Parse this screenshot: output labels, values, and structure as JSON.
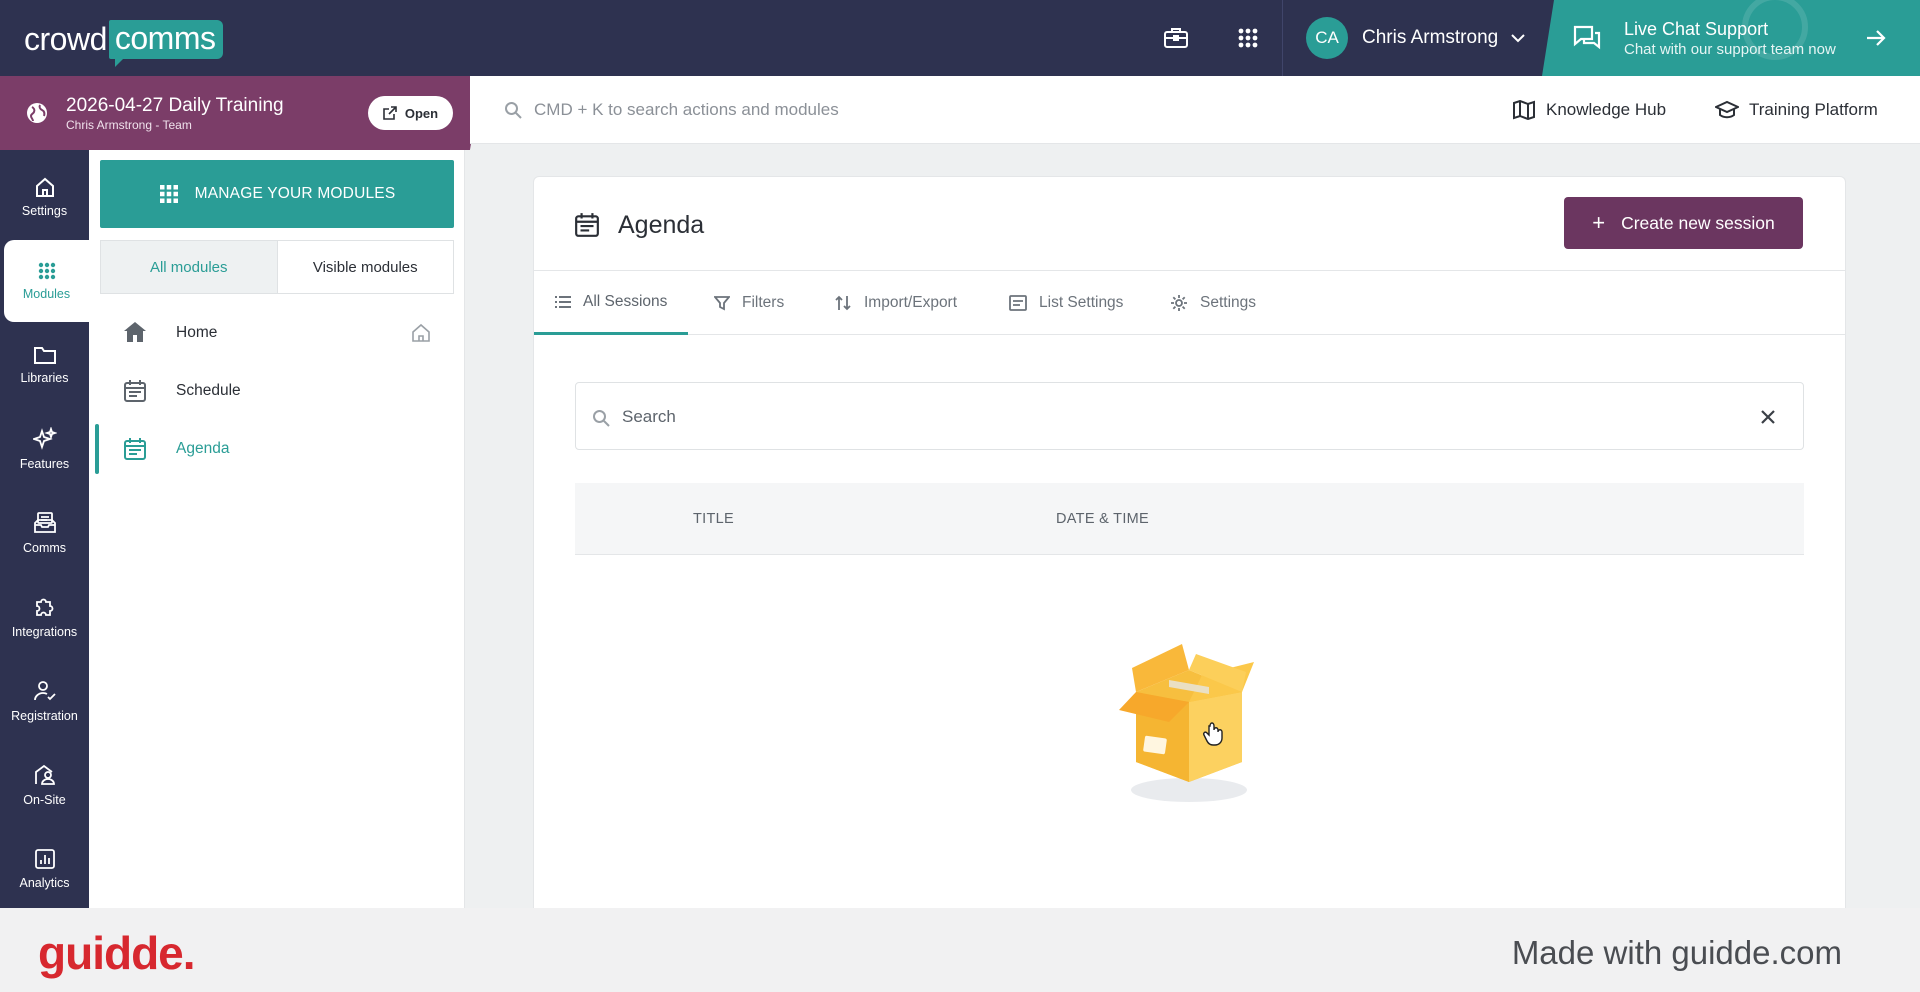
{
  "topbar": {
    "logo_left": "crowd",
    "logo_right": "comms",
    "user_initials": "CA",
    "user_name": "Chris Armstrong",
    "live_chat_title": "Live Chat Support",
    "live_chat_subtitle": "Chat with our support team now"
  },
  "event": {
    "title": "2026-04-27 Daily Training",
    "subtitle": "Chris Armstrong - Team",
    "open_label": "Open"
  },
  "search": {
    "placeholder": "CMD + K to search actions and modules"
  },
  "links": {
    "knowledge_hub": "Knowledge Hub",
    "training_platform": "Training Platform"
  },
  "rail": {
    "items": [
      {
        "label": "Settings",
        "icon": "home-icon"
      },
      {
        "label": "Modules",
        "icon": "grid-icon"
      },
      {
        "label": "Libraries",
        "icon": "folder-icon"
      },
      {
        "label": "Features",
        "icon": "sparkles-icon"
      },
      {
        "label": "Comms",
        "icon": "inbox-icon"
      },
      {
        "label": "Integrations",
        "icon": "puzzle-icon"
      },
      {
        "label": "Registration",
        "icon": "user-check-icon"
      },
      {
        "label": "On-Site",
        "icon": "location-user-icon"
      },
      {
        "label": "Analytics",
        "icon": "chart-icon"
      }
    ]
  },
  "modules": {
    "manage_label": "MANAGE YOUR MODULES",
    "toggle_all": "All modules",
    "toggle_visible": "Visible modules",
    "items": [
      {
        "label": "Home",
        "icon": "home-icon"
      },
      {
        "label": "Schedule",
        "icon": "calendar-icon"
      },
      {
        "label": "Agenda",
        "icon": "calendar-icon"
      }
    ]
  },
  "agenda": {
    "title": "Agenda",
    "create_label": "Create new session",
    "tabs": [
      {
        "label": "All Sessions",
        "icon": "list-icon"
      },
      {
        "label": "Filters",
        "icon": "filter-icon"
      },
      {
        "label": "Import/Export",
        "icon": "swap-icon"
      },
      {
        "label": "List Settings",
        "icon": "card-list-icon"
      },
      {
        "label": "Settings",
        "icon": "gear-icon"
      }
    ],
    "search_placeholder": "Search",
    "columns": [
      "TITLE",
      "DATE & TIME"
    ]
  },
  "footer": {
    "brand": "guidde.",
    "made_with": "Made with guidde.com"
  },
  "colors": {
    "navy": "#2e3250",
    "teal": "#2a9d96",
    "plum": "#7b3d68",
    "create_button": "#6b3660",
    "guidde_red": "#d7282f"
  }
}
